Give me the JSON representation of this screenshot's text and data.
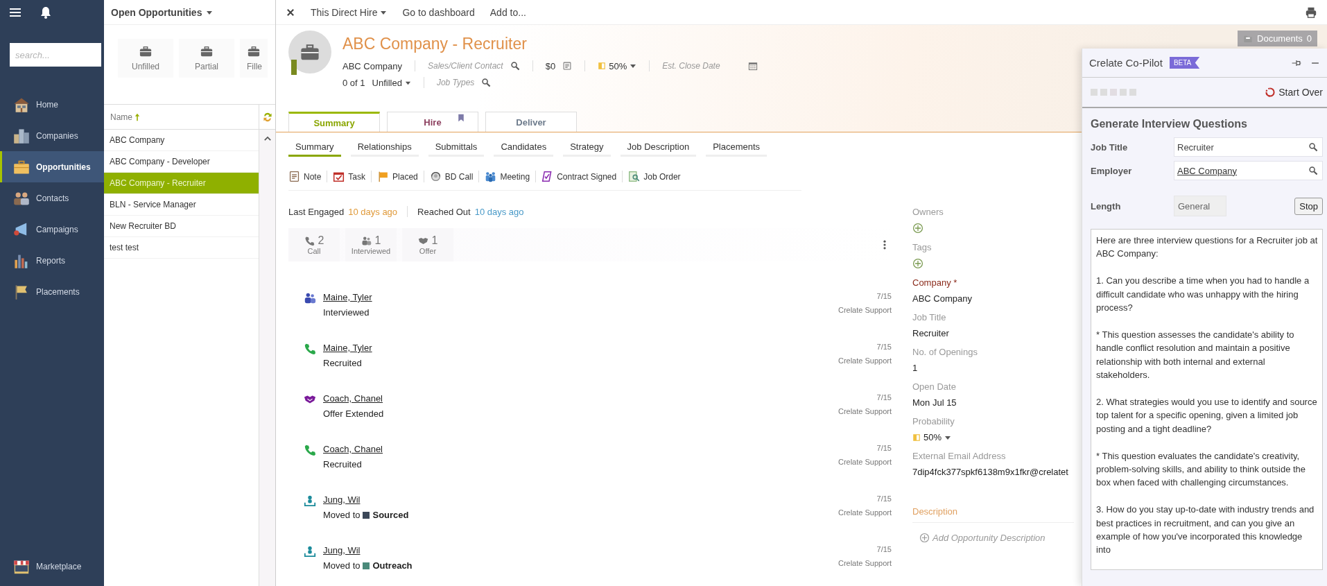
{
  "nav": {
    "search": {
      "placeholder": "search..."
    },
    "items": [
      {
        "label": "Home",
        "kind": "home",
        "selected": false
      },
      {
        "label": "Companies",
        "kind": "companies",
        "selected": false
      },
      {
        "label": "Opportunities",
        "kind": "opportunities",
        "selected": true
      },
      {
        "label": "Contacts",
        "kind": "contacts",
        "selected": false
      },
      {
        "label": "Campaigns",
        "kind": "campaigns",
        "selected": false
      },
      {
        "label": "Reports",
        "kind": "reports",
        "selected": false
      },
      {
        "label": "Placements",
        "kind": "placements",
        "selected": false
      }
    ],
    "bottom_items": [
      {
        "label": "Marketplace",
        "kind": "marketplace",
        "selected": false
      }
    ]
  },
  "list_panel": {
    "view": "Open Opportunities",
    "tiles": [
      {
        "label": "Unfilled"
      },
      {
        "label": "Partial"
      },
      {
        "label": "Fille"
      }
    ],
    "column": "Name",
    "rows": [
      {
        "label": "ABC Company",
        "selected": false
      },
      {
        "label": "ABC Company - Developer",
        "selected": false
      },
      {
        "label": "ABC Company - Recruiter",
        "selected": true
      },
      {
        "label": "BLN - Service Manager",
        "selected": false
      },
      {
        "label": "New Recruiter BD",
        "selected": false
      },
      {
        "label": "test test",
        "selected": false
      }
    ]
  },
  "toolbar": [
    {
      "label": "This Direct Hire",
      "kind": "dropdown"
    },
    {
      "label": "Go to dashboard",
      "kind": "link"
    },
    {
      "label": "Add to...",
      "kind": "link"
    }
  ],
  "record": {
    "title": "ABC Company - Recruiter",
    "company": "ABC Company",
    "contact_placeholder": "Sales/Client Contact",
    "amount": "$0",
    "probability": "50%",
    "close_date_placeholder": "Est. Close Date",
    "openings": "0 of 1",
    "status": "Unfilled",
    "job_types_placeholder": "Job Types",
    "documents": {
      "label": "Documents",
      "count": "0"
    }
  },
  "stage_tabs": [
    {
      "label": "Summary",
      "selected": true,
      "bookmarked": false,
      "color": "#8aa600"
    },
    {
      "label": "Hire",
      "selected": false,
      "bookmarked": true,
      "color": "#8c3f5e"
    },
    {
      "label": "Deliver",
      "selected": false,
      "bookmarked": false,
      "color": "#6d7b8c"
    }
  ],
  "sub_tabs": [
    {
      "label": "Summary",
      "selected": true
    },
    {
      "label": "Relationships",
      "selected": false
    },
    {
      "label": "Submittals",
      "selected": false
    },
    {
      "label": "Candidates",
      "selected": false
    },
    {
      "label": "Strategy",
      "selected": false
    },
    {
      "label": "Job Description",
      "selected": false
    },
    {
      "label": "Placements",
      "selected": false
    }
  ],
  "actions": [
    {
      "label": "Note",
      "kind": "note"
    },
    {
      "label": "Task",
      "kind": "task"
    },
    {
      "label": "Placed",
      "kind": "placed"
    },
    {
      "label": "BD Call",
      "kind": "bdcall"
    },
    {
      "label": "Meeting",
      "kind": "meeting"
    },
    {
      "label": "Contract Signed",
      "kind": "contract"
    },
    {
      "label": "Job Order",
      "kind": "joborder"
    }
  ],
  "engagement": {
    "last_engaged_label": "Last Engaged",
    "last_engaged": "10 days ago",
    "reached_out_label": "Reached Out",
    "reached_out": "10 days ago"
  },
  "stats": [
    {
      "kind": "call",
      "count": "2",
      "label": "Call"
    },
    {
      "kind": "interviewed",
      "count": "1",
      "label": "Interviewed"
    },
    {
      "kind": "offer",
      "count": "1",
      "label": "Offer"
    }
  ],
  "activities": [
    {
      "kind": "interviewed",
      "name": "Maine, Tyler",
      "status": "Interviewed",
      "date": "7/15",
      "by": "Crelate Support"
    },
    {
      "kind": "call",
      "name": "Maine, Tyler",
      "status": "Recruited",
      "date": "7/15",
      "by": "Crelate Support"
    },
    {
      "kind": "offer",
      "name": "Coach, Chanel",
      "status": "Offer Extended",
      "date": "7/15",
      "by": "Crelate Support"
    },
    {
      "kind": "call",
      "name": "Coach, Chanel",
      "status": "Recruited",
      "date": "7/15",
      "by": "Crelate Support"
    },
    {
      "kind": "moved",
      "name": "Jung, Wil",
      "status": "Moved to",
      "stage": "Sourced",
      "color": "#3b4758",
      "date": "7/15",
      "by": "Crelate Support"
    },
    {
      "kind": "moved",
      "name": "Jung, Wil",
      "status": "Moved to",
      "stage": "Outreach",
      "color": "#4a8a7a",
      "date": "7/15",
      "by": "Crelate Support"
    }
  ],
  "details": {
    "fields": [
      {
        "label": "Owners",
        "kind": "add",
        "required": false
      },
      {
        "label": "Tags",
        "kind": "add",
        "required": false
      },
      {
        "label": "Company *",
        "kind": "link",
        "value": "ABC Company",
        "required": true
      },
      {
        "label": "Job Title",
        "kind": "text",
        "value": "Recruiter",
        "required": false
      },
      {
        "label": "No. of Openings",
        "kind": "text",
        "value": "1",
        "required": false
      },
      {
        "label": "Open Date",
        "kind": "text",
        "value": "Mon Jul 15",
        "required": false
      },
      {
        "label": "Probability",
        "kind": "probability",
        "value": "50%",
        "required": false
      },
      {
        "label": "External Email Address",
        "kind": "text",
        "value": "7dip4fck377spkf6138m9x1fkr@crelatet",
        "required": false
      }
    ],
    "description": {
      "heading": "Description",
      "placeholder": "Add Opportunity Description"
    }
  },
  "copilot": {
    "title": "Crelate Co-Pilot",
    "badge": "BETA",
    "start_over": "Start Over",
    "heading": "Generate Interview Questions",
    "fields": [
      {
        "label": "Job Title",
        "value": "Recruiter",
        "kind": "text"
      },
      {
        "label": "Employer",
        "value": "ABC Company",
        "kind": "link"
      }
    ],
    "length": {
      "label": "Length",
      "value": "General"
    },
    "stop": "Stop",
    "output": "Here are three interview questions for a Recruiter job at ABC Company:\n\n1. Can you describe a time when you had to handle a difficult candidate who was unhappy with the hiring process?\n\n* This question assesses the candidate's ability to handle conflict resolution and maintain a positive relationship with both internal and external stakeholders.\n\n2. What strategies would you use to identify and source top talent for a specific opening, given a limited job posting and a tight deadline?\n\n* This question evaluates the candidate's creativity, problem-solving skills, and ability to think outside the box when faced with challenging circumstances.\n\n3. How do you stay up-to-date with industry trends and best practices in recruitment, and can you give an example of how you've incorporated this knowledge into"
  }
}
